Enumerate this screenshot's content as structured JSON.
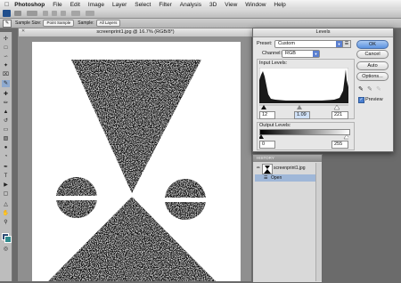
{
  "menubar": {
    "apple_icon": "apple-icon",
    "app_name": "Photoshop",
    "items": [
      "File",
      "Edit",
      "Image",
      "Layer",
      "Select",
      "Filter",
      "Analysis",
      "3D",
      "View",
      "Window",
      "Help"
    ]
  },
  "options_bar": {
    "sample_size_label": "Sample Size:",
    "sample_size_value": "Point Sample",
    "sample_label": "Sample:",
    "sample_value": "All Layers"
  },
  "document": {
    "tab_title": "screenprint1.jpg @ 16.7% (RGB/8*)"
  },
  "levels": {
    "title": "Levels",
    "preset_label": "Preset:",
    "preset_value": "Custom",
    "channel_label": "Channel:",
    "channel_value": "RGB",
    "input_levels_label": "Input Levels:",
    "input_black": "12",
    "input_gamma": "1.09",
    "input_white": "221",
    "output_levels_label": "Output Levels:",
    "output_black": "0",
    "output_white": "255",
    "buttons": {
      "ok": "OK",
      "cancel": "Cancel",
      "auto": "Auto",
      "options": "Options..."
    },
    "preview_label": "Preview",
    "preview_checked": true
  },
  "history": {
    "tab_label": "HISTORY",
    "snapshot_label": "screenprint1.jpg",
    "items": [
      "Open"
    ]
  },
  "colors": {
    "accent": "#5c93e0",
    "canvas_bg": "#8f8f8f",
    "workspace_bg": "#6b6b6b"
  }
}
